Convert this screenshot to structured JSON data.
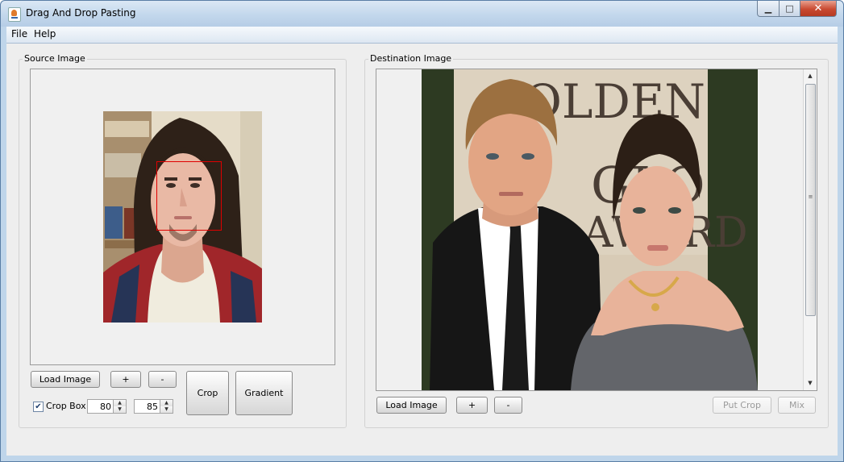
{
  "window": {
    "title": "Drag And Drop Pasting",
    "close_glyph": "✕",
    "minimize_glyph": "▁",
    "maximize_glyph": "□"
  },
  "menu": {
    "items": [
      "File",
      "Help"
    ]
  },
  "source": {
    "group_title": "Source Image",
    "load_button": "Load Image",
    "zoom_in": "+",
    "zoom_out": "-",
    "crop_button": "Crop",
    "gradient_button": "Gradient",
    "crop_box_label": "Crop Box",
    "crop_box_checked": true,
    "crop_width": "80",
    "crop_height": "85",
    "photo": {
      "skin": "#e9b9a5",
      "hair": "#2e2118",
      "shirt": "#f0ecde",
      "plaid_red": "#a0262a",
      "plaid_navy": "#263456",
      "wall": "#e5dcc8",
      "shelf": "#bfa27b"
    },
    "crop_box_color": "#e00000"
  },
  "destination": {
    "group_title": "Destination Image",
    "load_button": "Load Image",
    "zoom_in": "+",
    "zoom_out": "-",
    "put_crop_button": "Put Crop",
    "mix_button": "Mix",
    "put_crop_enabled": false,
    "mix_enabled": false,
    "backdrop_text": "GOLDEN",
    "backdrop_text_2": "GLO",
    "backdrop_text_3": "AWARD",
    "photo": {
      "backdrop": "#d8cbb6",
      "hedge": "#2d3a22",
      "suit": "#161616",
      "shirt": "#ffffff",
      "skin1": "#e2a584",
      "skin2": "#e8b39a",
      "hair1": "#9c7040",
      "hair2": "#2c1f16",
      "dress": "#63656a",
      "gold": "#d7a84a"
    }
  }
}
